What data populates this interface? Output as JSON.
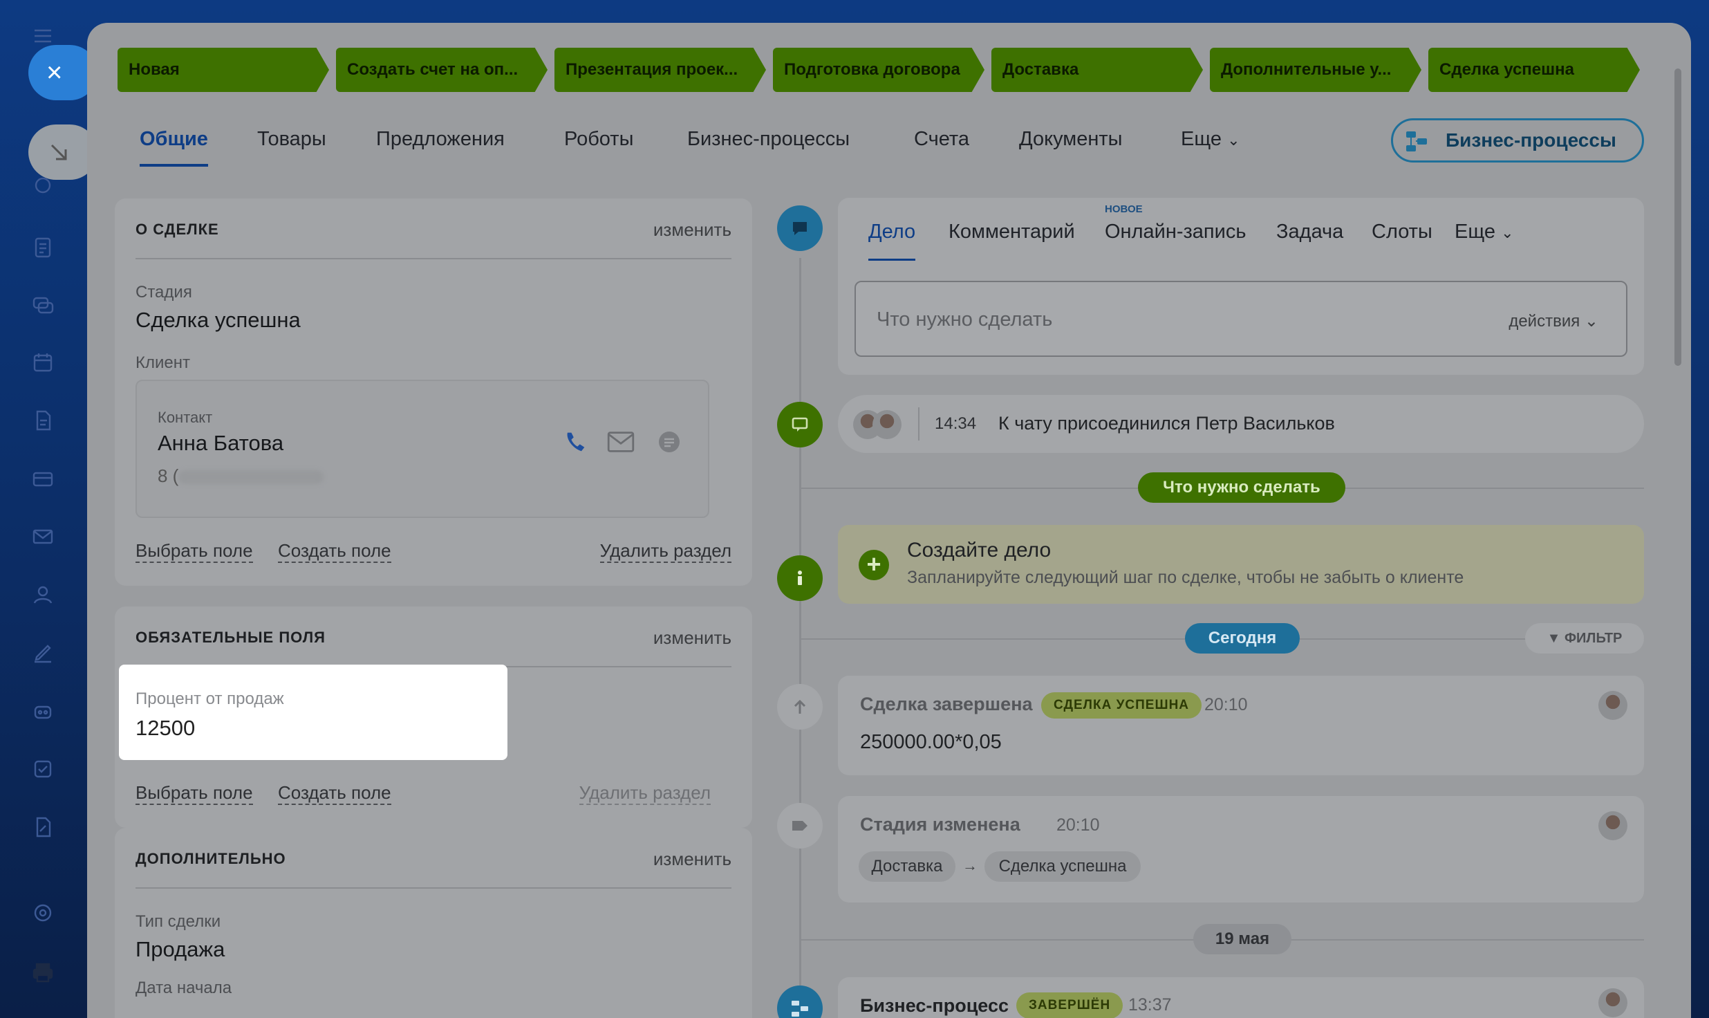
{
  "window": {
    "close_icon": "×"
  },
  "stages": [
    "Новая",
    "Создать счет на оп...",
    "Презентация проек...",
    "Подготовка договора",
    "Доставка",
    "Дополнительные у...",
    "Сделка успешна"
  ],
  "tabs": [
    "Общие",
    "Товары",
    "Предложения",
    "Роботы",
    "Бизнес-процессы",
    "Счета",
    "Документы",
    "Еще"
  ],
  "bp_button": "Бизнес-процессы",
  "about": {
    "title": "О СДЕЛКЕ",
    "edit": "изменить",
    "stage_label": "Стадия",
    "stage_value": "Сделка успешна",
    "client_label": "Клиент",
    "contact_label": "Контакт",
    "contact_name": "Анна Батова",
    "contact_phone": "8 (",
    "select_field": "Выбрать поле",
    "create_field": "Создать поле",
    "delete_section": "Удалить раздел"
  },
  "required": {
    "title": "ОБЯЗАТЕЛЬНЫЕ ПОЛЯ",
    "edit": "изменить",
    "field_label": "Процент от продаж",
    "field_value": "12500",
    "select_field": "Выбрать поле",
    "create_field": "Создать поле",
    "delete_section": "Удалить раздел"
  },
  "extra": {
    "title": "ДОПОЛНИТЕЛЬНО",
    "edit": "изменить",
    "type_label": "Тип сделки",
    "type_value": "Продажа",
    "start_label": "Дата начала"
  },
  "composer": {
    "tabs": [
      "Дело",
      "Комментарий",
      "Онлайн-запись",
      "Задача",
      "Слоты",
      "Еще"
    ],
    "new_badge": "НОВОЕ",
    "placeholder": "Что нужно сделать",
    "actions": "действия"
  },
  "chat_event": {
    "time": "14:34",
    "text": "К чату присоединился Петр Васильков"
  },
  "todo_pill": "Что нужно сделать",
  "create_task": {
    "title": "Создайте дело",
    "subtitle": "Запланируйте следующий шаг по сделке, чтобы не забыть о клиенте"
  },
  "today_pill": "Сегодня",
  "filter": "ФИЛЬТР",
  "deal_closed": {
    "title": "Сделка завершена",
    "badge": "СДЕЛКА УСПЕШНА",
    "time": "20:10",
    "text": "250000.00*0,05"
  },
  "stage_changed": {
    "title": "Стадия изменена",
    "time": "20:10",
    "from": "Доставка",
    "arrow": "→",
    "to": "Сделка успешна"
  },
  "date_pill": "19 мая",
  "bp_event": {
    "title": "Бизнес-процесс",
    "badge": "ЗАВЕРШЁН",
    "time": "13:37"
  },
  "colors": {
    "stage_green": "#3e7100",
    "accent_blue": "#0e3d86",
    "close_blue": "#2a7fd6",
    "highlight": "#ffffff"
  }
}
